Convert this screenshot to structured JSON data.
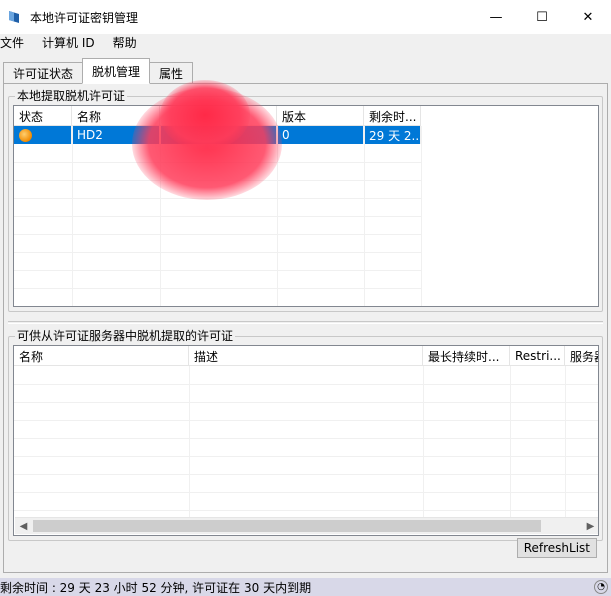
{
  "window": {
    "title": "本地许可证密钥管理",
    "minimize_glyph": "—",
    "maximize_glyph": "☐",
    "close_glyph": "✕"
  },
  "menu": [
    {
      "label": "文件"
    },
    {
      "label": "计算机 ID"
    },
    {
      "label": "帮助"
    }
  ],
  "tabs": [
    {
      "label": "许可证状态",
      "active": false
    },
    {
      "label": "脱机管理",
      "active": true
    },
    {
      "label": "属性",
      "active": false
    }
  ],
  "local_group": {
    "label": "本地提取脱机许可证",
    "columns": [
      "状态",
      "名称",
      "",
      "版本",
      "剩余时..."
    ],
    "rows": [
      {
        "status_icon": "orange-status-icon",
        "name": "HD2",
        "desc": "",
        "version": "0",
        "remaining": "29 天 2...",
        "selected": true
      }
    ]
  },
  "server_group": {
    "label": "可供从许可证服务器中脱机提取的许可证",
    "columns": [
      "名称",
      "描述",
      "最长持续时...",
      "Restri...",
      "服务器"
    ],
    "rows": []
  },
  "buttons": {
    "refresh": "RefreshList"
  },
  "scroll": {
    "left_arrow": "◀",
    "right_arrow": "▶"
  },
  "statusbar": {
    "text": "剩余时间 : 29 天 23 小时 52 分钟, 许可证在 30 天内到期"
  },
  "colors": {
    "selection": "#0078d7",
    "statusbar_bg": "#d8d8e8"
  }
}
